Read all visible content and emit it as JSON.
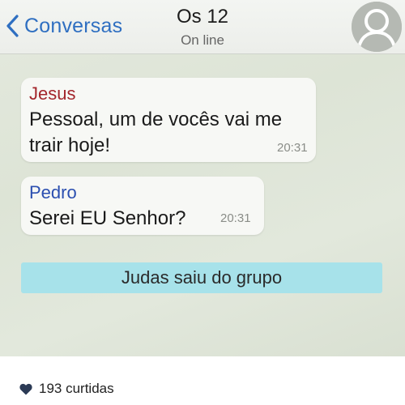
{
  "chat": {
    "header": {
      "back_label": "Conversas",
      "group_name": "Os 12",
      "status": "On line"
    },
    "messages": [
      {
        "sender": "Jesus",
        "text": "Pessoal, um de vocês vai me trair hoje!",
        "time": "20:31"
      },
      {
        "sender": "Pedro",
        "text": "Serei EU Senhor?",
        "time": "20:31"
      }
    ],
    "system_notice": "Judas saiu do grupo"
  },
  "post": {
    "likes_label": "193 curtidas"
  },
  "colors": {
    "accent_blue": "#2f6fc1",
    "jesus_name": "#a3262c",
    "pedro_name": "#2b4fb0",
    "banner": "#a7e2ea",
    "heart": "#2b3a55"
  },
  "icons": [
    "chevron-left-icon",
    "avatar-placeholder-icon",
    "heart-icon"
  ]
}
